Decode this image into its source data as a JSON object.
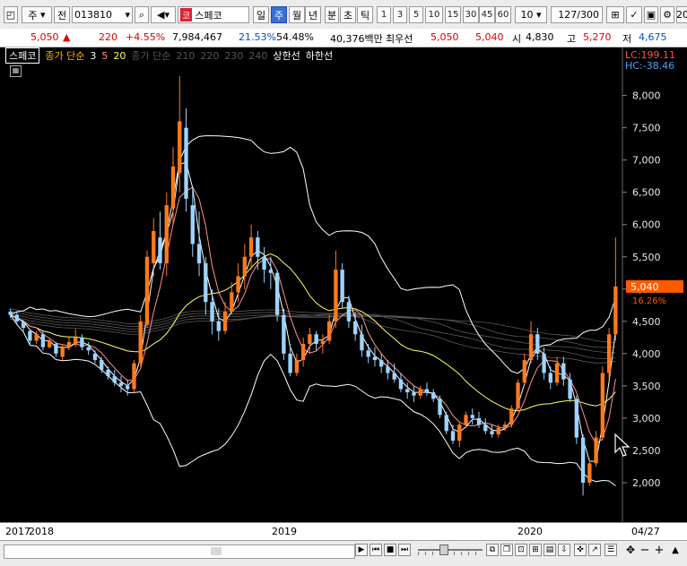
{
  "toolbar": {
    "period_options": [
      "주"
    ],
    "prev_label": "전",
    "code": "013810",
    "market_badge": "코",
    "stock_name": "스페코",
    "periods": [
      "일",
      "주",
      "월",
      "년"
    ],
    "active_period": "주",
    "sub_periods": [
      "분",
      "초",
      "틱"
    ],
    "intervals": [
      "1",
      "3",
      "5",
      "10",
      "15",
      "30",
      "45",
      "60"
    ],
    "interval_select": "10",
    "counter": "127/300",
    "trailing": "20"
  },
  "quote": {
    "price": "5,050",
    "change_arrow": "▲",
    "change": "220",
    "change_pct": "+4.55%",
    "volume": "7,984,467",
    "turnover_pct": "21.53%",
    "ratio_pct": "54.48%",
    "trade_value": "40,376백만",
    "best_label": "최우선",
    "ask": "5,050",
    "bid": "5,040",
    "open_label": "시",
    "open": "4,830",
    "high_label": "고",
    "high": "5,270",
    "low_label": "저",
    "low": "4,675"
  },
  "legend": {
    "name": "스페코",
    "ma_label": "종가 단순",
    "ma_short": [
      "3",
      "5",
      "20"
    ],
    "ma_long_label": "종가 단순",
    "ma_long": [
      "210",
      "220",
      "230",
      "240"
    ],
    "upper": "상한선",
    "lower": "하한선"
  },
  "colors": {
    "up": "#ff7a1a",
    "down": "#9dd4ff",
    "ma3": "#ffffff",
    "ma5": "#ff9090",
    "ma20": "#ffff66",
    "band": "#ffffff",
    "price_tag": "#ff5a00"
  },
  "price_axis": {
    "lc": "LC:199.11",
    "hc": "HC:-38.46",
    "ticks": [
      "8,000",
      "7,500",
      "7,000",
      "6,500",
      "6,000",
      "5,500",
      "5,000",
      "4,500",
      "4,000",
      "3,500",
      "3,000",
      "2,500",
      "2,000"
    ],
    "current": "5,040",
    "current_pct": "16.26%"
  },
  "x_axis": {
    "labels": [
      "2017",
      "2018",
      "2019",
      "2020",
      "04/27"
    ]
  },
  "chart_data": {
    "type": "candlestick",
    "timeframe": "weekly",
    "y_range": [
      1500,
      8300
    ],
    "candles": [
      [
        4650,
        4700,
        4550,
        4600
      ],
      [
        4600,
        4650,
        4450,
        4500
      ],
      [
        4500,
        4520,
        4350,
        4400
      ],
      [
        4350,
        4380,
        4150,
        4200
      ],
      [
        4200,
        4350,
        4150,
        4300
      ],
      [
        4300,
        4350,
        4050,
        4100
      ],
      [
        4100,
        4250,
        4080,
        4200
      ],
      [
        4150,
        4180,
        3950,
        4000
      ],
      [
        3950,
        4150,
        3900,
        4100
      ],
      [
        4100,
        4250,
        4050,
        4180
      ],
      [
        4150,
        4380,
        4100,
        4250
      ],
      [
        4250,
        4300,
        4050,
        4100
      ],
      [
        4100,
        4180,
        3980,
        4050
      ],
      [
        4000,
        4050,
        3850,
        3900
      ],
      [
        3900,
        3950,
        3700,
        3750
      ],
      [
        3750,
        3800,
        3600,
        3650
      ],
      [
        3650,
        3750,
        3500,
        3550
      ],
      [
        3550,
        3650,
        3400,
        3500
      ],
      [
        3500,
        3600,
        3350,
        3450
      ],
      [
        3450,
        3900,
        3400,
        3850
      ],
      [
        3850,
        4600,
        3800,
        4500
      ],
      [
        4450,
        5600,
        4400,
        5500
      ],
      [
        5400,
        6100,
        5200,
        5900
      ],
      [
        5800,
        6200,
        5300,
        5400
      ],
      [
        5400,
        6500,
        5200,
        6300
      ],
      [
        6250,
        7200,
        6000,
        6900
      ],
      [
        6800,
        8300,
        6500,
        7600
      ],
      [
        7500,
        7800,
        6200,
        6400
      ],
      [
        6300,
        6600,
        5500,
        5700
      ],
      [
        5700,
        6200,
        5200,
        5400
      ],
      [
        5400,
        5500,
        4600,
        4800
      ],
      [
        4800,
        5000,
        4300,
        4500
      ],
      [
        4500,
        4700,
        4200,
        4350
      ],
      [
        4350,
        4800,
        4300,
        4650
      ],
      [
        4650,
        5100,
        4600,
        4950
      ],
      [
        4950,
        5400,
        4800,
        5200
      ],
      [
        5200,
        5700,
        5000,
        5500
      ],
      [
        5500,
        6000,
        5300,
        5800
      ],
      [
        5800,
        5900,
        5300,
        5500
      ],
      [
        5500,
        5650,
        5100,
        5300
      ],
      [
        5300,
        5500,
        5000,
        5250
      ],
      [
        5250,
        5300,
        4500,
        4600
      ],
      [
        4600,
        4700,
        3900,
        4000
      ],
      [
        4000,
        4150,
        3650,
        3700
      ],
      [
        3700,
        4000,
        3650,
        3900
      ],
      [
        3900,
        4250,
        3800,
        4150
      ],
      [
        4150,
        4400,
        4000,
        4300
      ],
      [
        4300,
        4350,
        4050,
        4150
      ],
      [
        4150,
        4300,
        4000,
        4200
      ],
      [
        4200,
        4600,
        4150,
        4500
      ],
      [
        4500,
        5600,
        4400,
        5300
      ],
      [
        5300,
        5400,
        4700,
        4800
      ],
      [
        4800,
        4900,
        4400,
        4500
      ],
      [
        4500,
        4650,
        4200,
        4300
      ],
      [
        4300,
        4450,
        3950,
        4050
      ],
      [
        4050,
        4150,
        3850,
        3950
      ],
      [
        3950,
        4100,
        3800,
        3900
      ],
      [
        3900,
        4000,
        3700,
        3800
      ],
      [
        3800,
        3900,
        3600,
        3700
      ],
      [
        3700,
        3850,
        3550,
        3600
      ],
      [
        3600,
        3700,
        3400,
        3450
      ],
      [
        3450,
        3550,
        3300,
        3400
      ],
      [
        3400,
        3500,
        3250,
        3350
      ],
      [
        3350,
        3500,
        3300,
        3450
      ],
      [
        3450,
        3550,
        3350,
        3400
      ],
      [
        3400,
        3450,
        3250,
        3300
      ],
      [
        3300,
        3350,
        3000,
        3050
      ],
      [
        3050,
        3100,
        2750,
        2800
      ],
      [
        2800,
        2900,
        2600,
        2650
      ],
      [
        2650,
        2950,
        2550,
        2900
      ],
      [
        2900,
        3100,
        2850,
        3050
      ],
      [
        3050,
        3150,
        2900,
        3000
      ],
      [
        3000,
        3100,
        2850,
        2900
      ],
      [
        2900,
        3000,
        2750,
        2800
      ],
      [
        2800,
        2900,
        2700,
        2750
      ],
      [
        2750,
        2900,
        2700,
        2850
      ],
      [
        2850,
        2950,
        2800,
        2900
      ],
      [
        2900,
        3200,
        2850,
        3150
      ],
      [
        3150,
        3600,
        3100,
        3550
      ],
      [
        3550,
        4000,
        3500,
        3900
      ],
      [
        3900,
        4500,
        3850,
        4300
      ],
      [
        4300,
        4400,
        3900,
        4000
      ],
      [
        4000,
        4100,
        3600,
        3700
      ],
      [
        3700,
        3800,
        3450,
        3550
      ],
      [
        3550,
        3950,
        3500,
        3850
      ],
      [
        3850,
        3950,
        3500,
        3600
      ],
      [
        3600,
        3700,
        3250,
        3300
      ],
      [
        3300,
        3350,
        2600,
        2700
      ],
      [
        2700,
        2750,
        1800,
        2000
      ],
      [
        2000,
        2350,
        1950,
        2300
      ],
      [
        2300,
        2800,
        2250,
        2700
      ],
      [
        2700,
        3800,
        2650,
        3700
      ],
      [
        3700,
        4400,
        3600,
        4300
      ],
      [
        4300,
        5800,
        4200,
        5040
      ]
    ]
  }
}
